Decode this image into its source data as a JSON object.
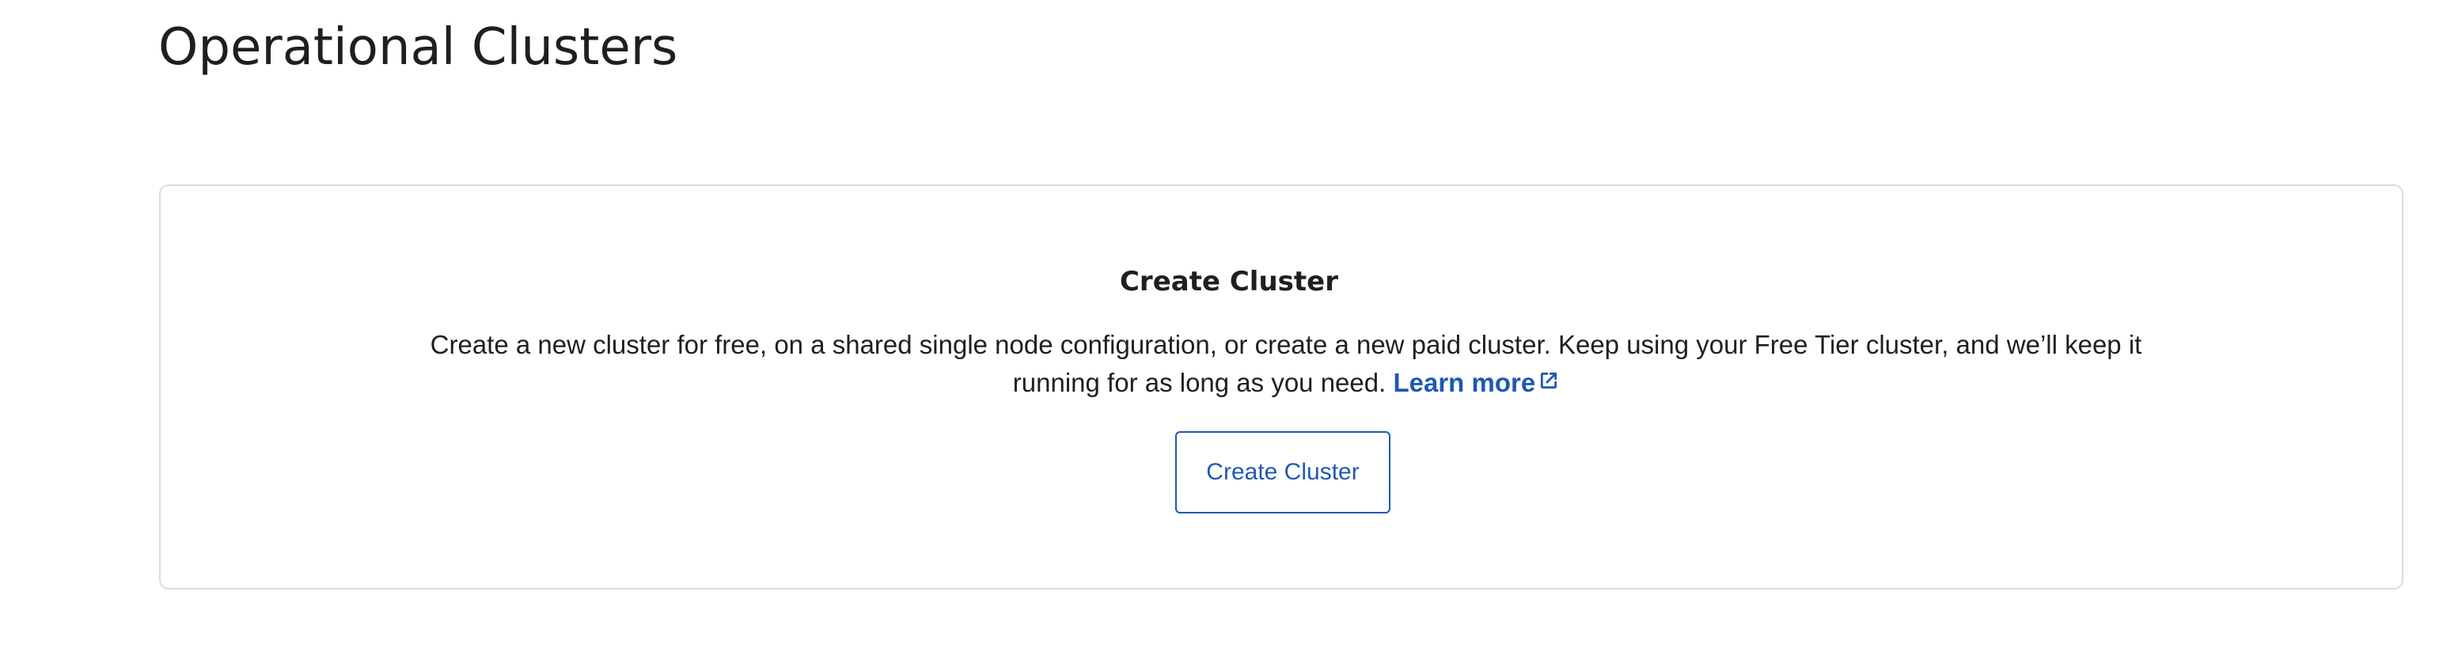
{
  "page": {
    "title": "Operational Clusters"
  },
  "empty_state": {
    "heading": "Create Cluster",
    "description_line1": "Create a new cluster for free, on a shared single node configuration, or create a new paid cluster. Keep using your Free Tier cluster, and we’ll keep it",
    "description_line2": "running for as long as you need.",
    "learn_more_label": "Learn more",
    "learn_more_icon": "external-link-icon",
    "button_label": "Create Cluster"
  },
  "colors": {
    "accent": "#1f58b5",
    "text": "#1f1f1f",
    "card_border": "#dcdcdc",
    "background": "#ffffff"
  }
}
